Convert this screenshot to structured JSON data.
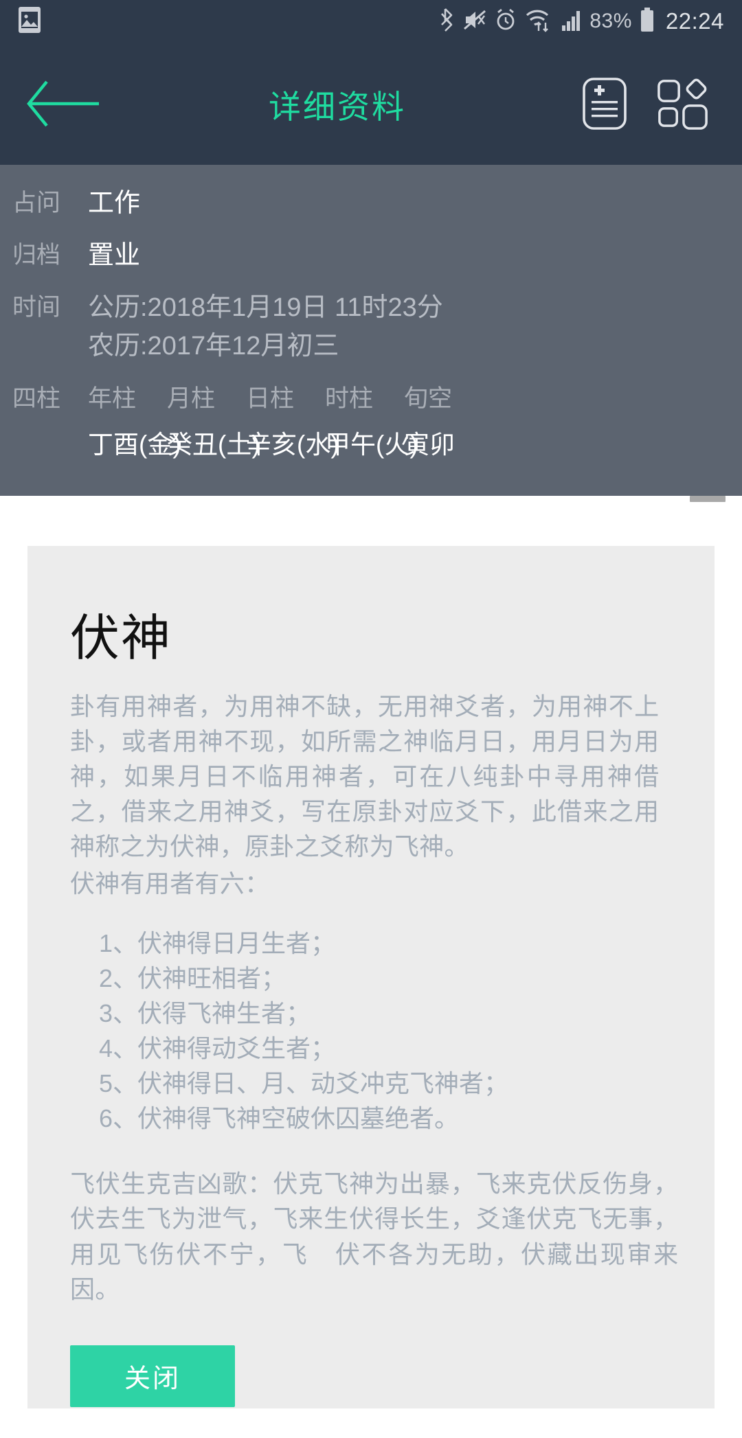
{
  "status_bar": {
    "icons": [
      "image-icon",
      "bluetooth-icon",
      "mute-icon",
      "alarm-icon",
      "wifi-icon",
      "signal-icon"
    ],
    "battery": "83%",
    "clock": "22:24"
  },
  "app_bar": {
    "back": "back-arrow",
    "title": "详细资料",
    "actions": [
      {
        "name": "add-note-icon"
      },
      {
        "name": "grid-layout-icon"
      }
    ]
  },
  "info": {
    "rows": [
      {
        "label": "占问",
        "value": "工作"
      },
      {
        "label": "归档",
        "value": "置业"
      }
    ],
    "time": {
      "label": "时间",
      "solar": "公历:2018年1月19日  11时23分",
      "lunar": "农历:2017年12月初三"
    },
    "pillars": {
      "label": "四柱",
      "columns": [
        "年柱",
        "月柱",
        "日柱",
        "时柱",
        "旬空"
      ],
      "values": [
        "丁酉(金)",
        "癸丑(土)",
        "辛亥(水)",
        "甲午(火)",
        "寅卯"
      ]
    }
  },
  "dialog": {
    "title": "伏神",
    "intro": "卦有用神者，为用神不缺，无用神爻者，为用神不上卦，或者用神不现，如所需之神临月日，用月日为用神，如果月日不临用神者，可在八纯卦中寻用神借之，借来之用神爻，写在原卦对应爻下，此借来之用神称之为伏神，原卦之爻称为飞神。",
    "list_heading": "伏神有用者有六：",
    "list_items": [
      "1、伏神得日月生者；",
      "2、伏神旺相者；",
      "3、伏得飞神生者；",
      "4、伏神得动爻生者；",
      "5、伏神得日、月、动爻冲克飞神者；",
      "6、伏神得飞神空破休囚墓绝者。"
    ],
    "verse": "飞伏生克吉凶歌：伏克飞神为出暴，飞来克伏反伤身，伏去生飞为泄气，飞来生伏得长生，爻逢伏克飞无事，用见飞伤伏不宁，飞　伏不各为无助，伏藏出现审来因。",
    "close_label": "关闭"
  },
  "colors": {
    "app_bar_bg": "#2e3a4b",
    "info_panel_bg": "#5c6470",
    "accent": "#1fdca0",
    "button": "#2ed3a5",
    "card_bg": "#ececec",
    "body_text": "#a3adb8"
  }
}
